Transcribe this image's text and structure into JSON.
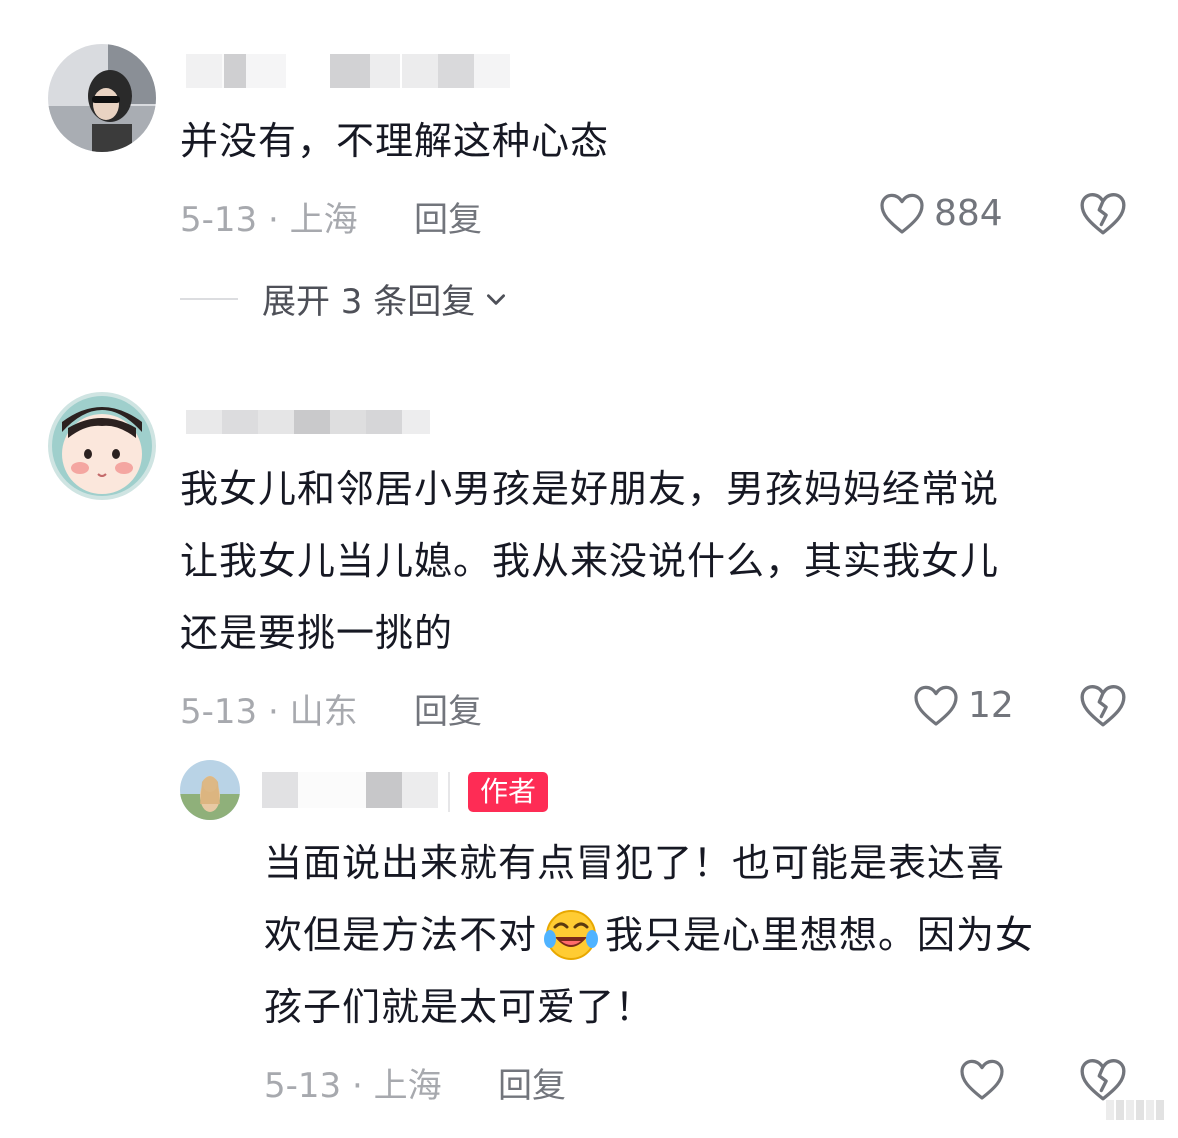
{
  "comments": [
    {
      "text": "并没有，不理解这种心态",
      "date_location": "5-13 · 上海",
      "reply_label": "回复",
      "like_count": "884",
      "expand_label": "展开 3 条回复"
    },
    {
      "text_lines": [
        "我女儿和邻居小男孩是好朋友，男孩妈妈经常说",
        "让我女儿当儿媳。我从来没说什么，其实我女儿",
        "还是要挑一挑的"
      ],
      "date_location": "5-13 · 山东",
      "reply_label": "回复",
      "like_count": "12"
    }
  ],
  "author_reply": {
    "badge": "作者",
    "text_lines": [
      "当面说出来就有点冒犯了！也可能是表达喜",
      "我只是心里想想。因为女",
      "孩子们就是太可爱了！"
    ],
    "line2_prefix": "欢但是方法不对",
    "emoji_name": "laughing-crying-emoji",
    "date_location": "5-13 · 上海",
    "reply_label": "回复"
  },
  "colors": {
    "accent": "#fe2c55",
    "meta_gray": "#a7a9ae",
    "reply_gray": "#72757c"
  }
}
